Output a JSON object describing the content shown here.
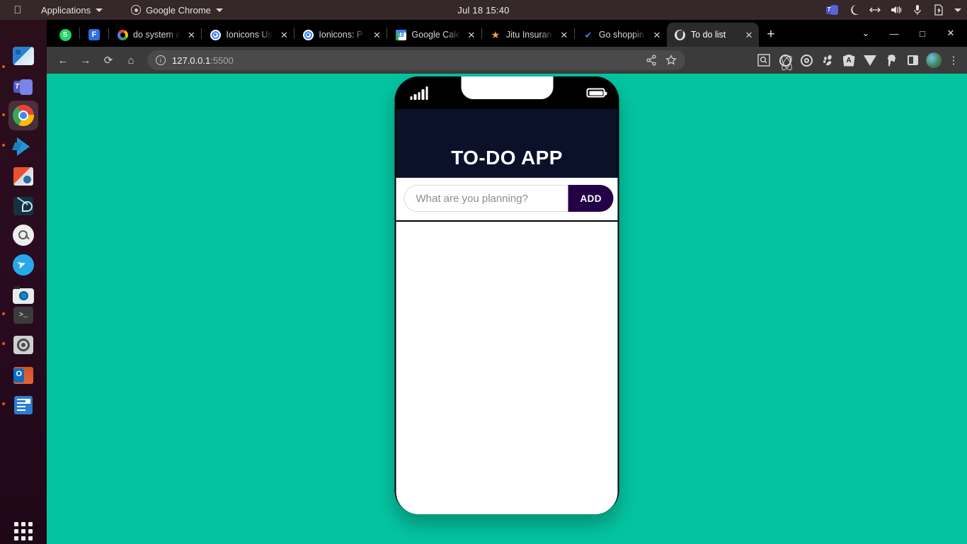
{
  "desktop": {
    "topbar": {
      "apple_logo": "",
      "applications_label": "Applications",
      "chrome_label": "Google Chrome",
      "clock": "Jul 18  15:40",
      "tray_icons": [
        "teams-icon",
        "night-mode-icon",
        "network-icon",
        "volume-icon",
        "microphone-icon",
        "power-icon",
        "system-menu-caret-icon"
      ]
    },
    "dock": {
      "items": [
        {
          "name": "files-app",
          "icon": "files-icon",
          "running": true,
          "active": false
        },
        {
          "name": "teams-app",
          "icon": "teams-icon",
          "running": false,
          "active": false
        },
        {
          "name": "google-chrome-app",
          "icon": "chrome-icon",
          "running": true,
          "active": true
        },
        {
          "name": "vscode-app",
          "icon": "vscode-icon",
          "running": true,
          "active": false
        },
        {
          "name": "powerpoint-app",
          "icon": "powerpoint-icon",
          "running": false,
          "active": false
        },
        {
          "name": "design-app",
          "icon": "pen-tool-icon",
          "running": false,
          "active": false
        },
        {
          "name": "search-app",
          "icon": "search-icon",
          "running": false,
          "active": false
        },
        {
          "name": "telegram-app",
          "icon": "telegram-icon",
          "running": false,
          "active": false
        },
        {
          "name": "camera-app",
          "icon": "camera-icon",
          "running": false,
          "active": false
        },
        {
          "name": "terminal-app",
          "icon": "terminal-icon",
          "running": true,
          "active": false
        },
        {
          "name": "settings-app",
          "icon": "disc-icon",
          "running": true,
          "active": false
        },
        {
          "name": "outlook-app",
          "icon": "outlook-icon",
          "running": false,
          "active": false
        },
        {
          "name": "word-app",
          "icon": "document-icon",
          "running": true,
          "active": false
        }
      ],
      "show_apps_label": "show-applications-grid"
    }
  },
  "browser": {
    "pinned_tabs": [
      {
        "label": "",
        "icon": "whatsapp-icon",
        "glyph": "S"
      },
      {
        "label": "",
        "icon": "figma-icon",
        "glyph": "F"
      }
    ],
    "tabs": [
      {
        "title": "do system a",
        "icon": "google-icon",
        "active": false
      },
      {
        "title": "Ionicons Us",
        "icon": "ionicons-icon",
        "active": false
      },
      {
        "title": "Ionicons: P",
        "icon": "ionicons-icon",
        "active": false
      },
      {
        "title": "Google Cale",
        "icon": "google-calendar-icon",
        "active": false
      },
      {
        "title": "Jitu Insuran",
        "icon": "star-icon",
        "active": false
      },
      {
        "title": "Go shoppin",
        "icon": "check-icon",
        "active": false
      },
      {
        "title": "To do list",
        "icon": "globe-icon",
        "active": true
      }
    ],
    "new_tab_label": "+",
    "tab_search_label": "⌄",
    "window_controls": {
      "minimize": "—",
      "maximize": "□",
      "close": "✕"
    },
    "toolbar": {
      "back_label": "←",
      "forward_label": "→",
      "reload_label": "⟳",
      "home_label": "⌂",
      "url_host": "127.0.0.1",
      "url_port": ":5500",
      "info_label": "i",
      "share_label": "share-icon",
      "bookmark_label": "star-icon",
      "extensions": [
        "search-page-icon",
        "react-devtools-icon",
        "target-icon",
        "gnome-icon",
        "angular-icon",
        "vue-icon",
        "puzzle-extensions-icon",
        "side-panel-icon"
      ],
      "profile_label": "avatar",
      "menu_label": "⋮"
    }
  },
  "page": {
    "background_color": "#04c4a0",
    "phone": {
      "status_bar": {
        "signal": "signal-bars-icon",
        "notch": "notch",
        "battery": "battery-icon"
      },
      "app": {
        "title": "TO-DO APP",
        "header_color": "#0a1128",
        "input_placeholder": "What are you planning?",
        "input_value": "",
        "add_button_label": "ADD",
        "add_button_color": "#240046",
        "todo_items": []
      }
    }
  }
}
